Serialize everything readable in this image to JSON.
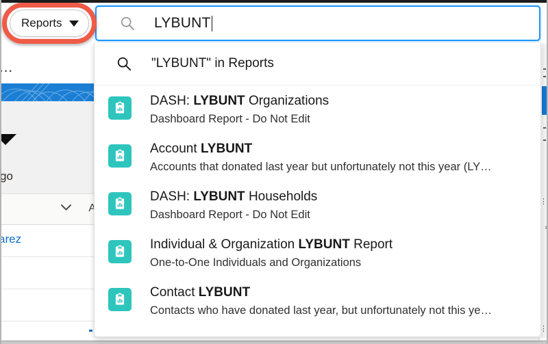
{
  "scope_selector": {
    "label": "Reports",
    "caret_icon": "chevron-down-icon",
    "annotation_color": "#ef5b46"
  },
  "search": {
    "value": "LYBUNT",
    "icon": "search-icon",
    "focus_color": "#1b96ff"
  },
  "dropdown": {
    "search_in_row": {
      "icon": "search-icon",
      "text": "\"LYBUNT\" in Reports"
    },
    "results": [
      {
        "icon": "report-icon",
        "title_prefix": "DASH: ",
        "title_match": "LYBUNT",
        "title_suffix": " Organizations",
        "subtitle": "Dashboard Report - Do Not Edit"
      },
      {
        "icon": "report-icon",
        "title_prefix": "Account ",
        "title_match": "LYBUNT",
        "title_suffix": "",
        "subtitle": "Accounts that donated last year but unfortunately not this year (LY…"
      },
      {
        "icon": "report-icon",
        "title_prefix": "DASH: ",
        "title_match": "LYBUNT",
        "title_suffix": " Households",
        "subtitle": "Dashboard Report - Do Not Edit"
      },
      {
        "icon": "report-icon",
        "title_prefix": "Individual & Organization ",
        "title_match": "LYBUNT",
        "title_suffix": " Report",
        "subtitle": "One-to-One Individuals and Organizations"
      },
      {
        "icon": "report-icon",
        "title_prefix": "Contact ",
        "title_match": "LYBUNT",
        "title_suffix": "",
        "subtitle": "Contacts who have donated last year, but unfortunately not this ye…"
      }
    ],
    "icon_color": "#2ec5bd"
  },
  "background": {
    "overflow_menu": "…",
    "partial_text": "go",
    "partial_link": "arez",
    "column_letter": "A",
    "banner_color": "#1a7fd4",
    "link_color": "#1170cf"
  }
}
